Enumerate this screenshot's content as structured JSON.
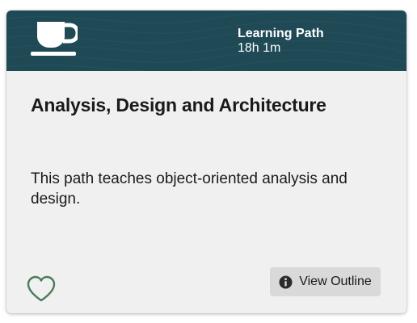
{
  "card": {
    "banner": {
      "icon": "coffee-cup-icon",
      "type_label": "Learning Path",
      "duration": "18h 1m",
      "background_color": "#1f4a55"
    },
    "title": "Analysis, Design and Architecture",
    "description": "This path teaches object-oriented analysis and design.",
    "actions": {
      "favorite_icon": "heart-outline-icon",
      "favorite_color": "#4d7a58",
      "view_outline_label": "View Outline",
      "view_outline_icon": "info-circle-icon"
    }
  }
}
